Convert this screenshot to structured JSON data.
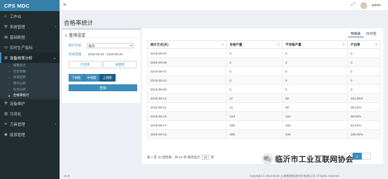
{
  "app": {
    "brand": "CPS MDC",
    "version": "v1.0"
  },
  "topbar": {
    "menu_icon": "hamburger-icon",
    "expand_icon": "expand-icon",
    "user": "admin"
  },
  "sidebar": {
    "items": [
      {
        "label": "工作台",
        "icon": "home-icon",
        "glyph": "⌂"
      },
      {
        "label": "系统管理",
        "icon": "settings-icon",
        "glyph": "⚒"
      },
      {
        "label": "基础数据",
        "icon": "data-icon",
        "glyph": "▤"
      },
      {
        "label": "实时生产指标",
        "icon": "monitor-icon",
        "glyph": "▭"
      },
      {
        "label": "设备效率分析",
        "icon": "chart-icon",
        "glyph": "▥"
      }
    ],
    "subitems": [
      {
        "label": "报警统计"
      },
      {
        "label": "历史参数"
      },
      {
        "label": "效率趋势"
      },
      {
        "label": "用时分析"
      },
      {
        "label": "综合分析"
      },
      {
        "label": "合格率统计"
      }
    ],
    "items_after": [
      {
        "label": "设备维护",
        "icon": "wrench-icon",
        "glyph": "⚒"
      },
      {
        "label": "可视化",
        "icon": "visual-icon",
        "glyph": "▥"
      },
      {
        "label": "刀具管理",
        "icon": "tool-icon",
        "glyph": "✂"
      },
      {
        "label": "能源管理",
        "icon": "energy-icon",
        "glyph": "◉"
      }
    ]
  },
  "page": {
    "title": "合格率统计"
  },
  "query": {
    "heading": "查询设定",
    "stat_label": "统计方式",
    "stat_value": "按天",
    "time_label": "时间范围",
    "time_value": "2018-08-20 - 2018-09-20",
    "tab_output": "产出率",
    "tab_quality": "质量率",
    "shifts": [
      "下调扳",
      "中调扳",
      "上调扳"
    ],
    "submit": "查询"
  },
  "result": {
    "tabs": [
      "数据表",
      "柱状图"
    ],
    "columns": [
      "统计方式(天)",
      "合格产量",
      "不合格产量",
      "产出率"
    ],
    "rows": [
      [
        "2018-09-20",
        "0",
        "0",
        "0"
      ],
      [
        "2018-09-08",
        "0",
        "0",
        "0"
      ],
      [
        "2018-09-07",
        "0",
        "0",
        "0"
      ],
      [
        "2018-09-10",
        "0",
        "0",
        "0"
      ],
      [
        "2018-09-05",
        "0",
        "0",
        "0"
      ],
      [
        "2018-09-12",
        "37",
        "56",
        "151.35%"
      ],
      [
        "2018-09-11",
        "41",
        "39",
        "95.12%"
      ],
      [
        "2018-09-15",
        "103",
        "102",
        "99.03%"
      ],
      [
        "2018-09-17",
        "349",
        "294",
        "84.24%"
      ],
      [
        "2018-09-13",
        "408",
        "444",
        "109.36%"
      ]
    ],
    "pager_text": "第 1 至 10 项结果，共 10 项 每页显示",
    "page_size": "10",
    "pager_suffix": "项",
    "pages": [
      "‹",
      "1",
      "›"
    ]
  },
  "footer": {
    "copyright": "Copyright © 2013-2018 上海智能制造科技有限公司  All rights reserved"
  },
  "watermark": {
    "text": "临沂市工业互联网协会"
  }
}
